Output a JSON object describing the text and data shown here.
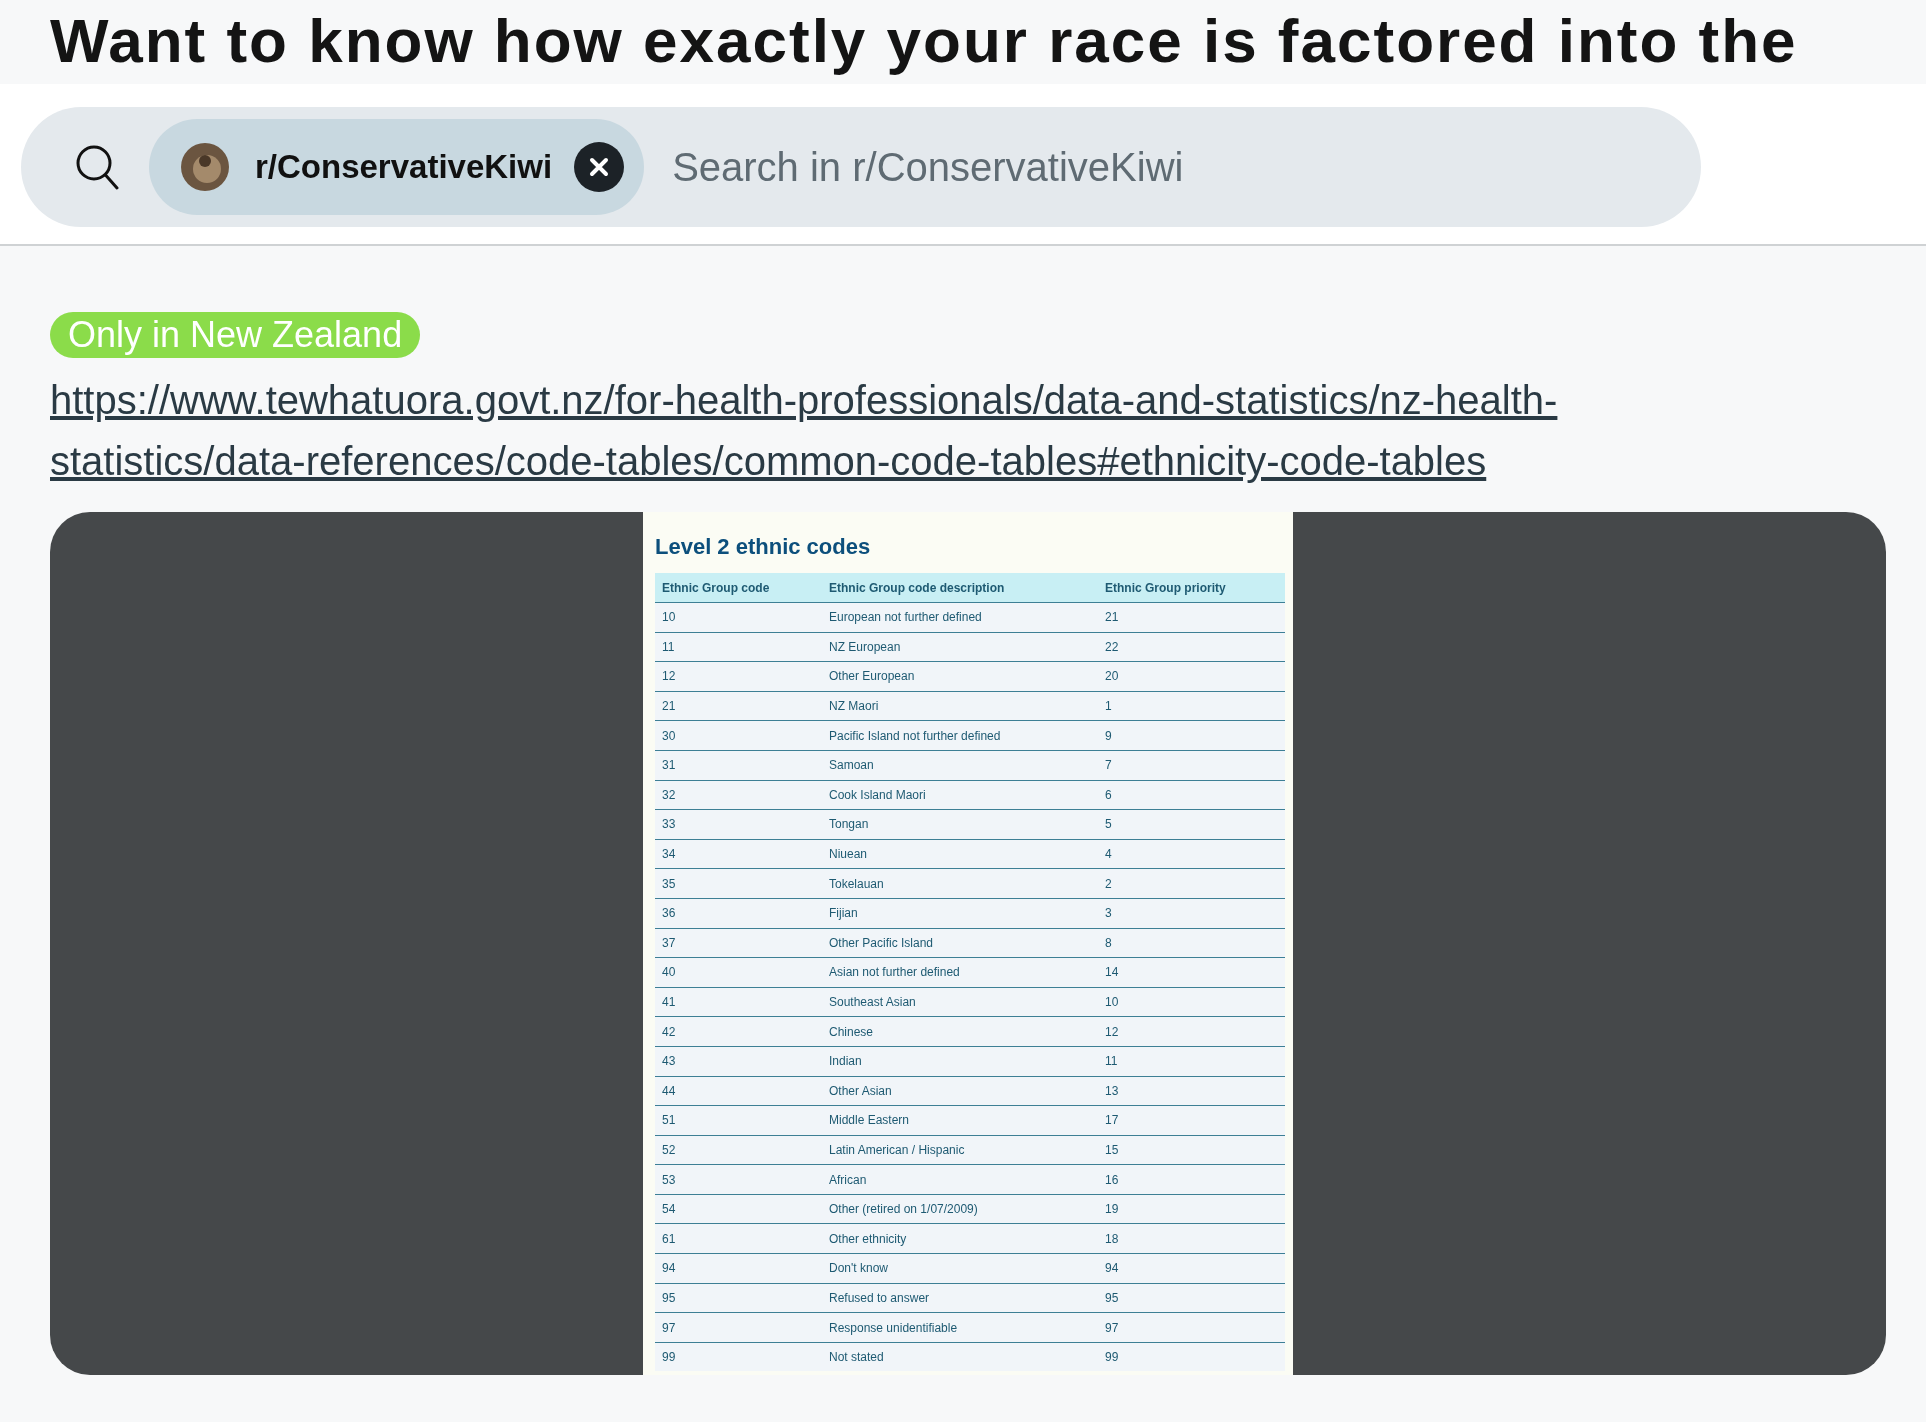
{
  "post_title": "Want to know how exactly your race is factored into the",
  "search": {
    "community_chip": "r/ConservativeKiwi",
    "placeholder": "Search in r/ConservativeKiwi"
  },
  "flair": {
    "label": "Only in New Zealand",
    "color": "#8bdc4a"
  },
  "link": "https://www.tewhatuora.govt.nz/for-health-professionals/data-and-statistics/nz-health-statistics/data-references/code-tables/common-code-tables#ethnicity-code-tables",
  "image": {
    "heading": "Level 2 ethnic codes",
    "columns": [
      "Ethnic Group code",
      "Ethnic Group code description",
      "Ethnic Group priority"
    ],
    "rows": [
      [
        "10",
        "European not further defined",
        "21"
      ],
      [
        "11",
        "NZ European",
        "22"
      ],
      [
        "12",
        "Other European",
        "20"
      ],
      [
        "21",
        "NZ Maori",
        "1"
      ],
      [
        "30",
        "Pacific Island not further defined",
        "9"
      ],
      [
        "31",
        "Samoan",
        "7"
      ],
      [
        "32",
        "Cook Island Maori",
        "6"
      ],
      [
        "33",
        "Tongan",
        "5"
      ],
      [
        "34",
        "Niuean",
        "4"
      ],
      [
        "35",
        "Tokelauan",
        "2"
      ],
      [
        "36",
        "Fijian",
        "3"
      ],
      [
        "37",
        "Other Pacific Island",
        "8"
      ],
      [
        "40",
        "Asian not further defined",
        "14"
      ],
      [
        "41",
        "Southeast Asian",
        "10"
      ],
      [
        "42",
        "Chinese",
        "12"
      ],
      [
        "43",
        "Indian",
        "11"
      ],
      [
        "44",
        "Other Asian",
        "13"
      ],
      [
        "51",
        "Middle Eastern",
        "17"
      ],
      [
        "52",
        "Latin American / Hispanic",
        "15"
      ],
      [
        "53",
        "African",
        "16"
      ],
      [
        "54",
        "Other (retired on 1/07/2009)",
        "19"
      ],
      [
        "61",
        "Other ethnicity",
        "18"
      ],
      [
        "94",
        "Don't know",
        "94"
      ],
      [
        "95",
        "Refused to answer",
        "95"
      ],
      [
        "97",
        "Response unidentifiable",
        "97"
      ],
      [
        "99",
        "Not stated",
        "99"
      ]
    ]
  }
}
